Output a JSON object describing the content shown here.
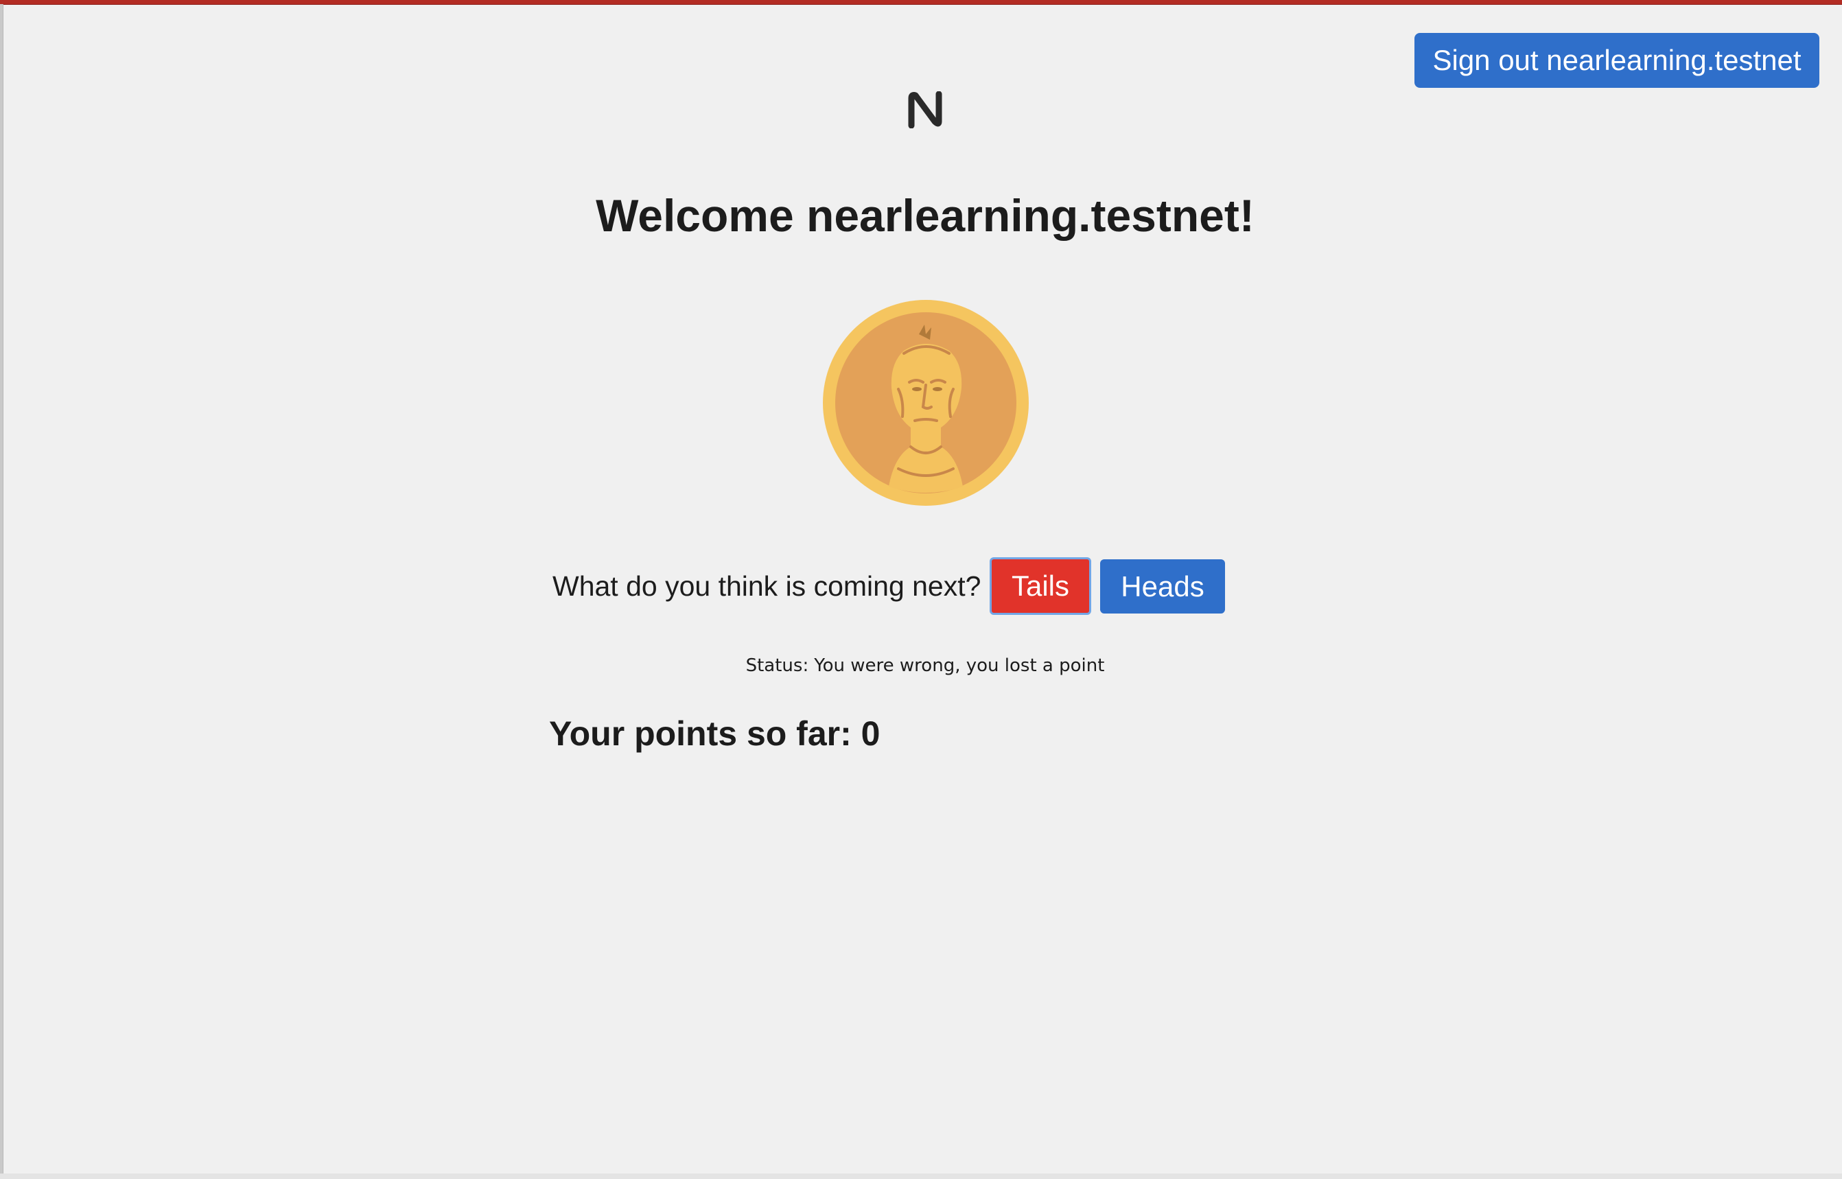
{
  "header": {
    "signout_label": "Sign out nearlearning.testnet",
    "logo_icon": "near-logo-icon"
  },
  "main": {
    "welcome": "Welcome nearlearning.testnet!",
    "coin_icon": "coin-portrait-icon",
    "question": "What do you think is coming next?",
    "buttons": {
      "tails": "Tails",
      "heads": "Heads"
    },
    "status_label": "Status:",
    "status_message": "You were wrong, you lost a point",
    "points_label": "Your points so far:",
    "points_value": "0"
  },
  "colors": {
    "background": "#f0f0f0",
    "primary_blue": "#2f6fca",
    "tails_red": "#e1332a",
    "coin_outer": "#f5c55f",
    "coin_inner": "#e3a158",
    "text": "#1c1c1c"
  }
}
